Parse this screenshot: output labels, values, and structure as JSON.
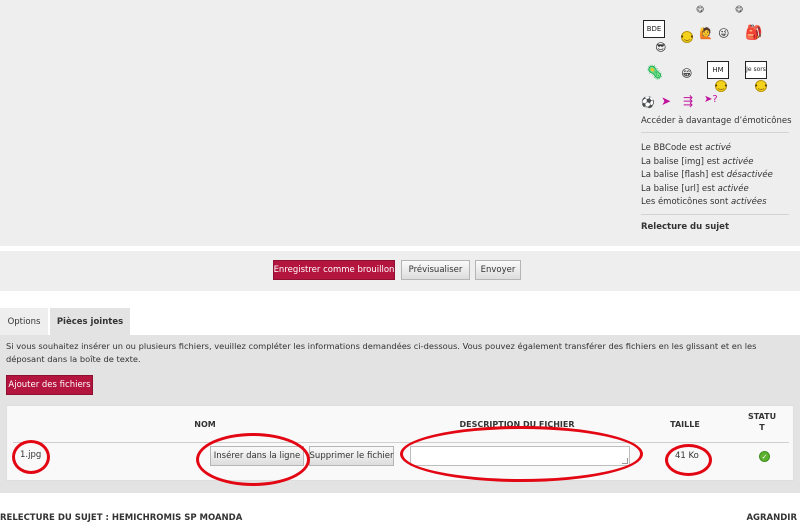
{
  "emoticons": {
    "sign_bde": "BDE",
    "sign_hm": "HM",
    "sign_jesors": "Je sors",
    "more_link": "Accéder à davantage d’émoticônes"
  },
  "status": {
    "bbcode": {
      "prefix": "Le BBCode est ",
      "value": "activé"
    },
    "img": {
      "prefix": "La balise [img] est ",
      "value": "activée"
    },
    "flash": {
      "prefix": "La balise [flash] est ",
      "value": "désactivée"
    },
    "url": {
      "prefix": "La balise [url] est ",
      "value": "activée"
    },
    "smilies": {
      "prefix": "Les émoticônes sont ",
      "value": "activées"
    }
  },
  "review_link": "Relecture du sujet",
  "submit": {
    "save_draft": "Enregistrer comme brouillon",
    "preview": "Prévisualiser",
    "send": "Envoyer"
  },
  "tabs": {
    "options": "Options",
    "attachments": "Pièces jointes"
  },
  "attachments": {
    "info": "Si vous souhaitez insérer un ou plusieurs fichiers, veuillez compléter les informations demandées ci-dessous. Vous pouvez également transférer des fichiers en les glissant et en les déposant dans la boîte de texte.",
    "add_button": "Ajouter des fichiers",
    "headers": {
      "name": "NOM",
      "description": "DESCRIPTION DU FICHIER",
      "size": "TAILLE",
      "status_line1": "STATU",
      "status_line2": "T"
    },
    "file": {
      "name": "1.jpg",
      "insert_button": "Insérer dans la ligne",
      "delete_button": "Supprimer le fichier",
      "description": "",
      "size": "41 Ko"
    }
  },
  "bottom": {
    "review_title": "RELECTURE DU SUJET : HEMICHROMIS SP MOANDA",
    "enlarge": "AGRANDIR"
  },
  "colors": {
    "primary_button": "#b4153f",
    "annotation": "#e30613",
    "status_ok": "#5cb230"
  }
}
